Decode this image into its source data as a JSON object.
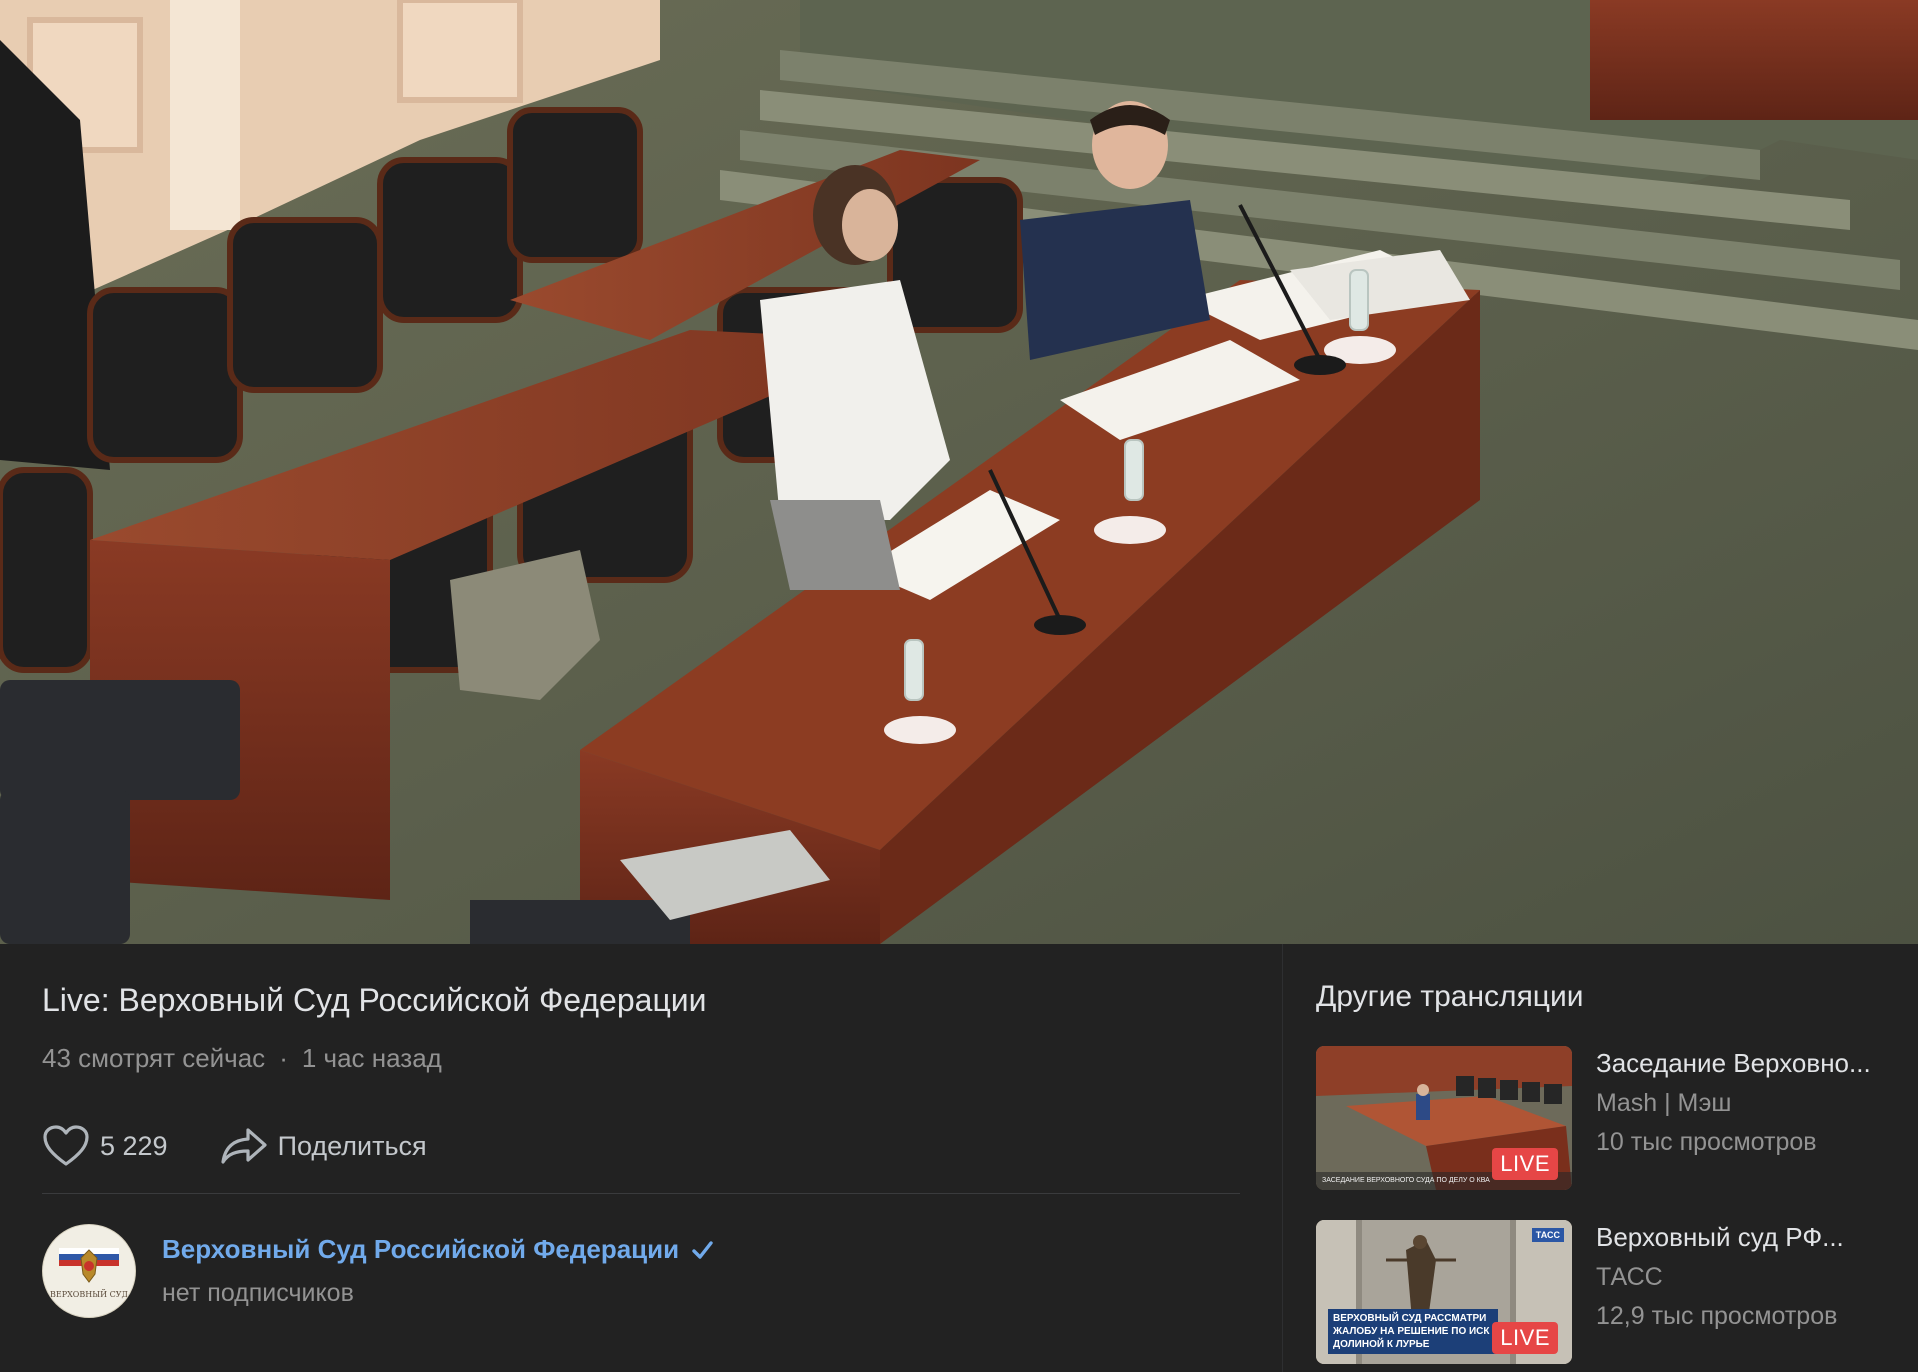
{
  "player": {
    "scene": "courtroom-video-frame"
  },
  "video": {
    "title": "Live: Верховный Суд Российской Федерации",
    "viewers": "43 смотрят сейчас",
    "separator": "·",
    "time_ago": "1 час назад",
    "likes": "5 229",
    "share_label": "Поделиться"
  },
  "channel": {
    "name": "Верховный Суд Российской Федерации",
    "subscribers": "нет подписчиков",
    "avatar_text": "ВЕРХОВНЫЙ СУД",
    "verified_icon": "verified-check-icon"
  },
  "sidebar": {
    "title": "Другие трансляции",
    "items": [
      {
        "title": "Заседание Верховно...",
        "channel": "Mash | Мэш",
        "views": "10 тыс просмотров",
        "badge": "LIVE",
        "thumb_caption": "ЗАСЕДАНИЕ ВЕРХОВНОГО СУДА ПО ДЕЛУ О КВА"
      },
      {
        "title": "Верховный суд РФ...",
        "channel": "ТАСС",
        "views": "12,9 тыс просмотров",
        "badge": "LIVE",
        "thumb_caption": "ВЕРХОВНЫЙ СУД РАССМАТРИ ЖАЛОБУ НА РЕШЕНИЕ ПО ИСК ДОЛИНОЙ К ЛУРЬЕ",
        "thumb_logo": "ТАСС"
      }
    ]
  },
  "colors": {
    "background": "#222222",
    "link": "#71aaeb",
    "muted": "#939393",
    "live": "#e64646"
  }
}
